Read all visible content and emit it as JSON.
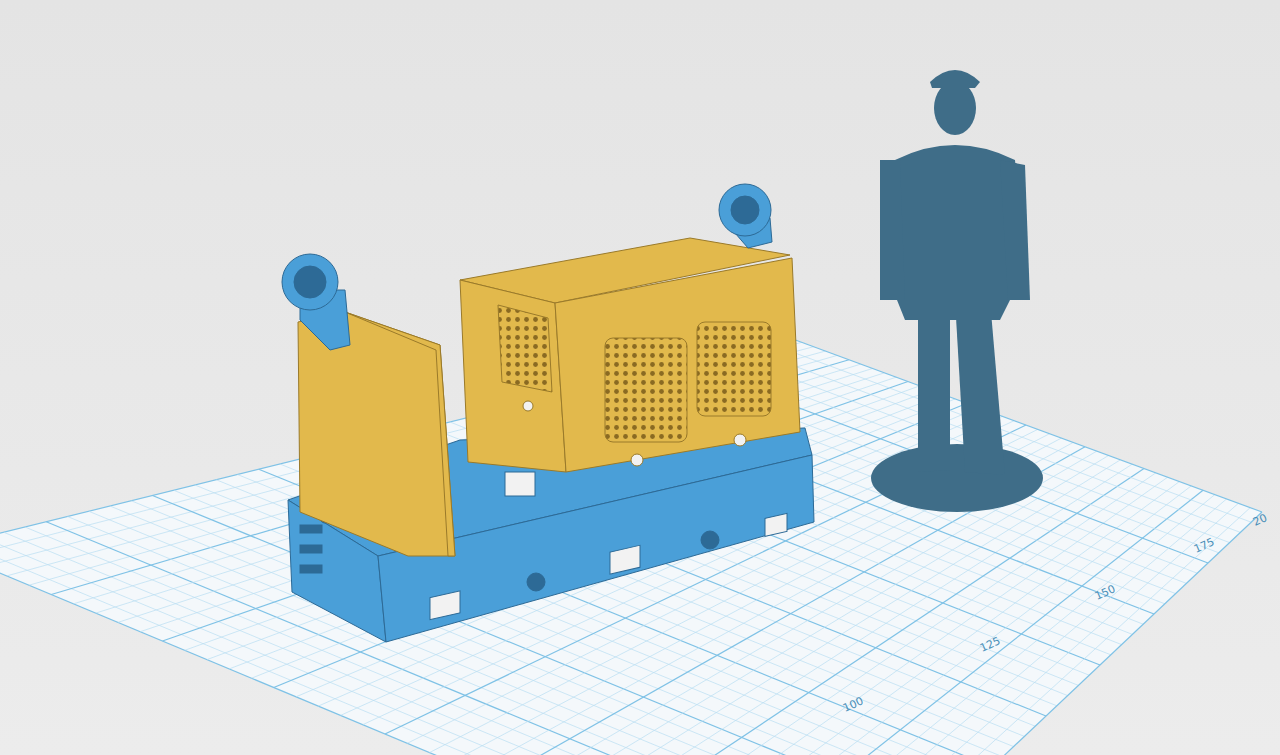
{
  "viewport": {
    "grid_labels": [
      "100",
      "125",
      "150",
      "175",
      "20"
    ]
  },
  "models": [
    {
      "name": "chassis",
      "color": "#4a9fd8"
    },
    {
      "name": "body",
      "color": "#e2b94c"
    },
    {
      "name": "figure",
      "color": "#3f6d88"
    }
  ]
}
